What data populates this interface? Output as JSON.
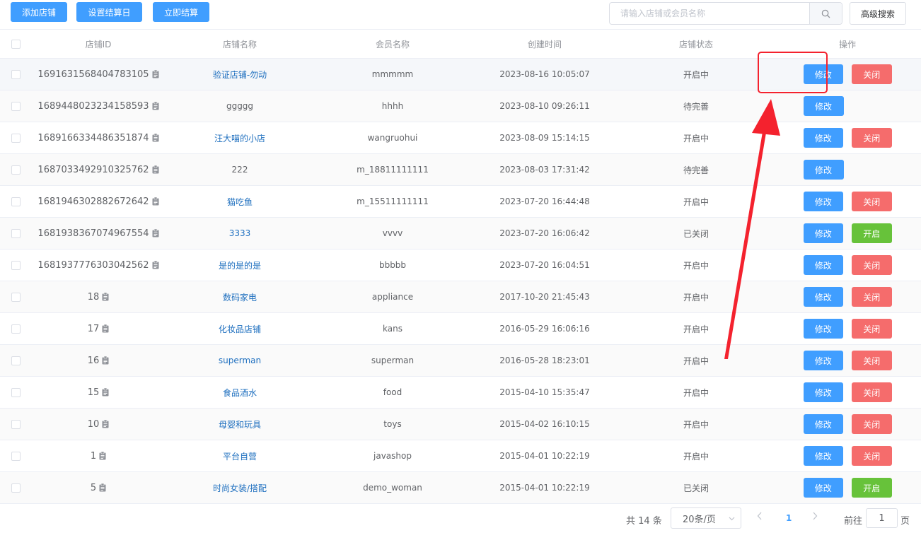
{
  "toolbar": {
    "add_shop": "添加店铺",
    "set_settle_day": "设置结算日",
    "settle_now": "立即结算",
    "search_placeholder": "请输入店铺或会员名称",
    "advanced_search": "高级搜索"
  },
  "columns": {
    "id": "店铺ID",
    "shop_name": "店铺名称",
    "member_name": "会员名称",
    "created": "创建时间",
    "status": "店铺状态",
    "ops": "操作"
  },
  "icons": {
    "search": "search-icon",
    "copy": "clipboard-icon"
  },
  "colors": {
    "primary": "#409eff",
    "danger": "#f56c6c",
    "success": "#67c23a",
    "link": "#1e6fbf",
    "annotation": "#f4222e"
  },
  "rows": [
    {
      "id": "1691631568404783105",
      "shop": "验证店铺-勿动",
      "shop_link": true,
      "member": "mmmmm",
      "created": "2023-08-16 10:05:07",
      "status": "开启中",
      "edit": "修改",
      "action": "关闭",
      "action_type": "close"
    },
    {
      "id": "1689448023234158593",
      "shop": "ggggg",
      "shop_link": false,
      "member": "hhhh",
      "created": "2023-08-10 09:26:11",
      "status": "待完善",
      "edit": "修改",
      "action": "",
      "action_type": "none"
    },
    {
      "id": "1689166334486351874",
      "shop": "汪大喵的小店",
      "shop_link": true,
      "member": "wangruohui",
      "created": "2023-08-09 15:14:15",
      "status": "开启中",
      "edit": "修改",
      "action": "关闭",
      "action_type": "close"
    },
    {
      "id": "1687033492910325762",
      "shop": "222",
      "shop_link": false,
      "member": "m_18811111111",
      "created": "2023-08-03 17:31:42",
      "status": "待完善",
      "edit": "修改",
      "action": "",
      "action_type": "none"
    },
    {
      "id": "1681946302882672642",
      "shop": "猫吃鱼",
      "shop_link": true,
      "member": "m_15511111111",
      "created": "2023-07-20 16:44:48",
      "status": "开启中",
      "edit": "修改",
      "action": "关闭",
      "action_type": "close"
    },
    {
      "id": "1681938367074967554",
      "shop": "3333",
      "shop_link": true,
      "member": "vvvv",
      "created": "2023-07-20 16:06:42",
      "status": "已关闭",
      "edit": "修改",
      "action": "开启",
      "action_type": "open"
    },
    {
      "id": "1681937776303042562",
      "shop": "是的是的是",
      "shop_link": true,
      "member": "bbbbb",
      "created": "2023-07-20 16:04:51",
      "status": "开启中",
      "edit": "修改",
      "action": "关闭",
      "action_type": "close"
    },
    {
      "id": "18",
      "shop": "数码家电",
      "shop_link": true,
      "member": "appliance",
      "created": "2017-10-20 21:45:43",
      "status": "开启中",
      "edit": "修改",
      "action": "关闭",
      "action_type": "close"
    },
    {
      "id": "17",
      "shop": "化妆品店铺",
      "shop_link": true,
      "member": "kans",
      "created": "2016-05-29 16:06:16",
      "status": "开启中",
      "edit": "修改",
      "action": "关闭",
      "action_type": "close"
    },
    {
      "id": "16",
      "shop": "superman",
      "shop_link": true,
      "member": "superman",
      "created": "2016-05-28 18:23:01",
      "status": "开启中",
      "edit": "修改",
      "action": "关闭",
      "action_type": "close"
    },
    {
      "id": "15",
      "shop": "食品酒水",
      "shop_link": true,
      "member": "food",
      "created": "2015-04-10 15:35:47",
      "status": "开启中",
      "edit": "修改",
      "action": "关闭",
      "action_type": "close"
    },
    {
      "id": "10",
      "shop": "母婴和玩具",
      "shop_link": true,
      "member": "toys",
      "created": "2015-04-02 16:10:15",
      "status": "开启中",
      "edit": "修改",
      "action": "关闭",
      "action_type": "close"
    },
    {
      "id": "1",
      "shop": "平台自营",
      "shop_link": true,
      "member": "javashop",
      "created": "2015-04-01 10:22:19",
      "status": "开启中",
      "edit": "修改",
      "action": "关闭",
      "action_type": "close"
    },
    {
      "id": "5",
      "shop": "时尚女装/搭配",
      "shop_link": true,
      "member": "demo_woman",
      "created": "2015-04-01 10:22:19",
      "status": "已关闭",
      "edit": "修改",
      "action": "开启",
      "action_type": "open"
    }
  ],
  "pagination": {
    "total": "共 14 条",
    "page_size": "20条/页",
    "current_page": "1",
    "goto_label": "前往",
    "goto_value": "1",
    "page_unit": "页"
  }
}
